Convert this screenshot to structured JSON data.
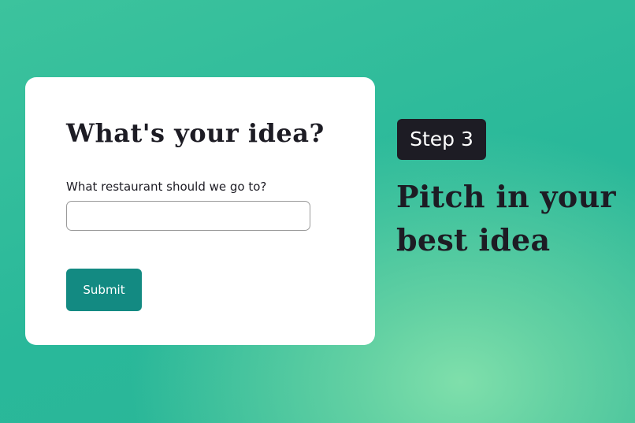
{
  "form": {
    "title": "What's your idea?",
    "field_label": "What restaurant should we go to?",
    "field_value": "",
    "field_placeholder": "",
    "submit_label": "Submit"
  },
  "aside": {
    "step_badge": "Step 3",
    "tagline": "Pitch in your best idea"
  },
  "colors": {
    "background_primary": "#2bb99a",
    "background_highlight": "#7fdfab",
    "card": "#ffffff",
    "button": "#138a82",
    "badge": "#1d1c24",
    "text_dark": "#1d1c24"
  }
}
